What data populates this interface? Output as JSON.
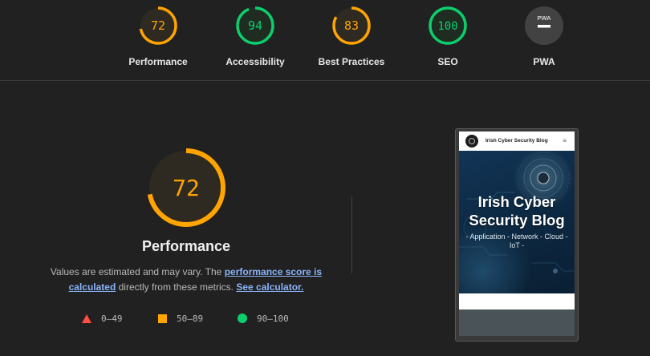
{
  "colors": {
    "fail": "#ff4e42",
    "average": "#ffa400",
    "pass": "#0cce6b",
    "na": "#9e9e9e",
    "link": "#8ab4f8"
  },
  "categories": [
    {
      "id": "performance",
      "label": "Performance",
      "score": "72",
      "value": 72,
      "status": "average"
    },
    {
      "id": "accessibility",
      "label": "Accessibility",
      "score": "94",
      "value": 94,
      "status": "pass"
    },
    {
      "id": "best-practices",
      "label": "Best Practices",
      "score": "83",
      "value": 83,
      "status": "average"
    },
    {
      "id": "seo",
      "label": "SEO",
      "score": "100",
      "value": 100,
      "status": "pass"
    },
    {
      "id": "pwa",
      "label": "PWA",
      "score": "",
      "value": null,
      "status": "na",
      "badge": "PWA"
    }
  ],
  "main": {
    "score": "72",
    "value": 72,
    "title": "Performance",
    "desc_prefix": "Values are estimated and may vary. The ",
    "desc_link1": "performance score is calculated",
    "desc_middle": " directly from these metrics. ",
    "desc_link2": "See calculator."
  },
  "legend": [
    {
      "shape": "triangle",
      "range": "0–49"
    },
    {
      "shape": "square",
      "range": "50–89"
    },
    {
      "shape": "circle",
      "range": "90–100"
    }
  ],
  "screenshot": {
    "site_name": "Irish Cyber Security Blog",
    "menu_glyph": "≡",
    "hero_title": "Irish Cyber Security Blog",
    "hero_subtitle": "- Application - Network - Cloud - IoT -"
  }
}
